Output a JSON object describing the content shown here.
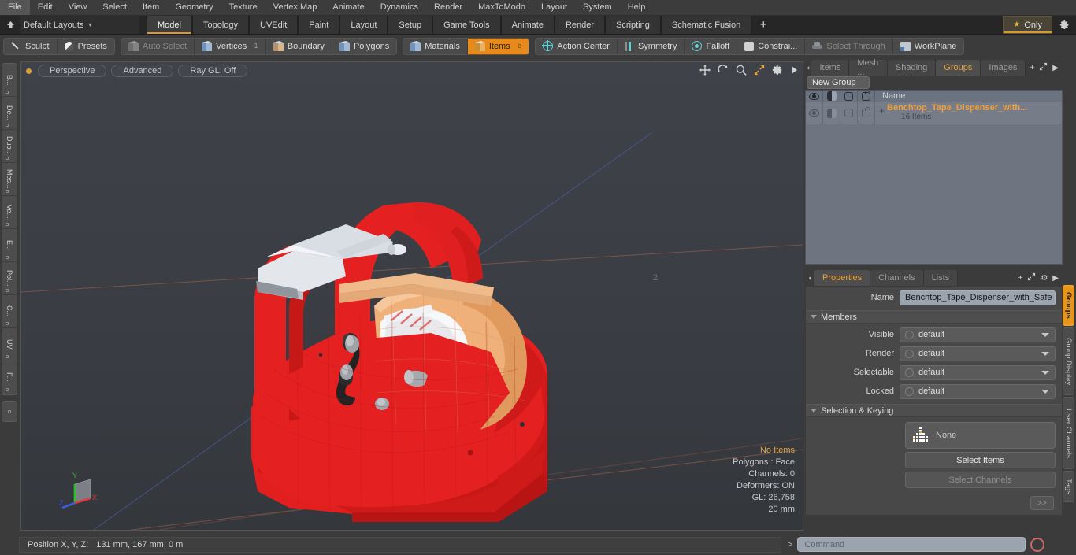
{
  "menubar": {
    "items": [
      "File",
      "Edit",
      "View",
      "Select",
      "Item",
      "Geometry",
      "Texture",
      "Vertex Map",
      "Animate",
      "Dynamics",
      "Render",
      "MaxToModo",
      "Layout",
      "System",
      "Help"
    ]
  },
  "layoutbar": {
    "preset": "Default Layouts",
    "caret": "▾",
    "home_icon": "home-icon",
    "tabs": [
      {
        "label": "Model",
        "active": true
      },
      {
        "label": "Topology",
        "active": false
      },
      {
        "label": "UVEdit",
        "active": false
      },
      {
        "label": "Paint",
        "active": false
      },
      {
        "label": "Layout",
        "active": false
      },
      {
        "label": "Setup",
        "active": false
      },
      {
        "label": "Game Tools",
        "active": false
      },
      {
        "label": "Animate",
        "active": false
      },
      {
        "label": "Render",
        "active": false
      },
      {
        "label": "Scripting",
        "active": false
      },
      {
        "label": "Schematic Fusion",
        "active": false
      }
    ],
    "add_tab": "+",
    "only_label": "Only",
    "star": "★",
    "gear": "⚙"
  },
  "modebar": {
    "left_group": [
      {
        "label": "Sculpt",
        "icon": "pen-icon",
        "state": "normal"
      },
      {
        "label": "Presets",
        "icon": "sphere-icon",
        "state": "normal"
      }
    ],
    "select_group": [
      {
        "label": "Auto Select",
        "icon": "cube-icon",
        "state": "disabled",
        "badge": ""
      },
      {
        "label": "Vertices",
        "icon": "cube-blue-icon",
        "state": "normal",
        "badge": "1"
      },
      {
        "label": "Boundary",
        "icon": "cube-tan-icon",
        "state": "normal",
        "badge": ""
      },
      {
        "label": "Polygons",
        "icon": "cube-icon",
        "state": "normal",
        "badge": ""
      }
    ],
    "items_group": [
      {
        "label": "Materials",
        "icon": "cube-blue-icon",
        "state": "normal",
        "badge": ""
      },
      {
        "label": "Items",
        "icon": "cube-orange-icon",
        "state": "selected",
        "badge": "5"
      }
    ],
    "right_group": [
      {
        "label": "Action Center",
        "icon": "action-center-icon",
        "state": "normal"
      },
      {
        "label": "Symmetry",
        "icon": "symmetry-icon",
        "state": "normal"
      },
      {
        "label": "Falloff",
        "icon": "falloff-icon",
        "state": "normal"
      },
      {
        "label": "Constrai...",
        "icon": "constraint-icon",
        "state": "normal"
      },
      {
        "label": "Select Through",
        "icon": "select-through-icon",
        "state": "disabled"
      },
      {
        "label": "WorkPlane",
        "icon": "workplane-icon",
        "state": "normal"
      }
    ]
  },
  "left_strip": {
    "tabs": [
      "B...",
      "De...",
      "Dup...",
      "Mes...",
      "Ve...",
      "E...",
      "Pol...",
      "C...",
      "UV",
      "F..."
    ]
  },
  "viewport": {
    "pills": [
      "Perspective",
      "Advanced",
      "Ray GL: Off"
    ],
    "nav_icons": [
      "move-icon",
      "rotate-icon",
      "zoom-icon",
      "fit-icon",
      "gear-icon",
      "play-icon"
    ],
    "stats": [
      "No Items",
      "Polygons : Face",
      "Channels: 0",
      "Deformers: ON",
      "GL: 26,758",
      "20 mm"
    ],
    "axis_labels": {
      "x": "X",
      "y": "Y",
      "z": "Z"
    },
    "marker": "2",
    "model_colors": {
      "body_red": "#e02020",
      "tape_tan": "#efb079",
      "plastic_white": "#e8eaee",
      "metal_grey": "#9a9a9a",
      "handle_black": "#222222"
    }
  },
  "right_panel": {
    "tabs": [
      {
        "label": "Items",
        "active": false
      },
      {
        "label": "Mesh ...",
        "active": false
      },
      {
        "label": "Shading",
        "active": false
      },
      {
        "label": "Groups",
        "active": true
      },
      {
        "label": "Images",
        "active": false
      }
    ],
    "add": "+",
    "new_group_button": "New Group",
    "list_header": {
      "columns": [
        "visible-icon",
        "render-icon",
        "select-icon",
        "lock-icon"
      ],
      "name": "Name"
    },
    "rows": [
      {
        "title": "Benchtop_Tape_Dispenser_with...",
        "subtitle": "16 Items",
        "expander": "+"
      }
    ]
  },
  "properties": {
    "tabs": [
      {
        "label": "Properties",
        "active": true
      },
      {
        "label": "Channels",
        "active": false
      },
      {
        "label": "Lists",
        "active": false
      }
    ],
    "add": "+",
    "name_label": "Name",
    "name_value": "Benchtop_Tape_Dispenser_with_Safe",
    "members_section": "Members",
    "member_rows": [
      {
        "label": "Visible",
        "value": "default"
      },
      {
        "label": "Render",
        "value": "default"
      },
      {
        "label": "Selectable",
        "value": "default"
      },
      {
        "label": "Locked",
        "value": "default"
      }
    ],
    "selection_section": "Selection & Keying",
    "selection_value": "None",
    "select_items_button": "Select Items",
    "select_channels_button": "Select Channels",
    "expand_button": ">>"
  },
  "right_strip": {
    "tabs": [
      {
        "label": "Groups",
        "active": true
      },
      {
        "label": "Group Display",
        "active": false
      },
      {
        "label": "User Channels",
        "active": false
      },
      {
        "label": "Tags",
        "active": false
      }
    ]
  },
  "bottombar": {
    "position_label": "Position X, Y, Z:",
    "position_value": "131 mm, 167 mm, 0 m",
    "command_prompt": ">",
    "command_placeholder": "Command",
    "record_icon": "record-icon"
  }
}
